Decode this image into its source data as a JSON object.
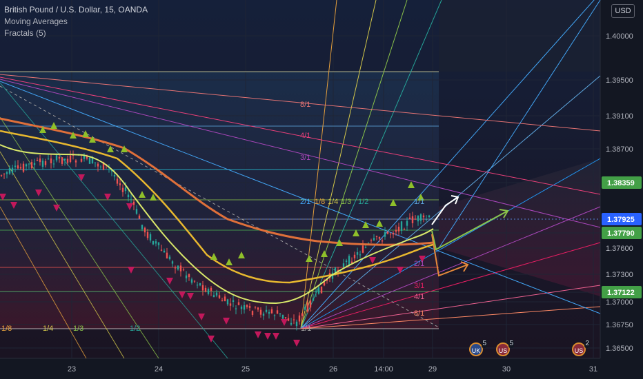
{
  "legend": {
    "title": "British Pound / U.S. Dollar, 15, OANDA",
    "ind1": "Moving Averages",
    "ind2": "Fractals (5)"
  },
  "currency_button": "USD",
  "colors": {
    "background": "#131722",
    "ma_slow": "#e0703a",
    "ma_mid": "#e8b82f",
    "ma_fast": "#d9e86a",
    "bull_candle": "#26a69a",
    "bear_candle": "#ef5350",
    "fractal_up": "#8fbf2a",
    "fractal_down": "#c2185b",
    "price_badge_green": "#43a047",
    "price_badge_blue": "#2962ff"
  },
  "price_axis": {
    "ticks": [
      "1.40000",
      "1.39500",
      "1.39100",
      "1.38700",
      "1.38359",
      "1.37925",
      "1.37790",
      "1.37600",
      "1.37300",
      "1.37122",
      "1.37000",
      "1.36750",
      "1.36500"
    ],
    "badges": [
      {
        "label": "1.38359",
        "color": "#43a047"
      },
      {
        "label": "1.37925",
        "color": "#2962ff"
      },
      {
        "label": "1.37790",
        "color": "#43a047"
      },
      {
        "label": "1.37122",
        "color": "#43a047"
      }
    ]
  },
  "time_axis": [
    "23",
    "24",
    "25",
    "26",
    "14:00",
    "29",
    "30",
    "31"
  ],
  "gann_fan_labels_bottom": [
    "1/8",
    "1/4",
    "1/3",
    "1/2"
  ],
  "gann_fan_labels_upper": [
    "8/1",
    "4/1",
    "3/1",
    "2/1",
    "1/8",
    "1/4",
    "1/3",
    "1/2",
    "1/1"
  ],
  "gann_fan_labels_lower": [
    "2/1",
    "3/1",
    "4/1",
    "8/1",
    "1/1"
  ],
  "events": [
    {
      "name": "uk-event",
      "count": "5",
      "flag": "UK"
    },
    {
      "name": "us-event",
      "count": "5",
      "flag": "US"
    },
    {
      "name": "multi-event",
      "count": "2",
      "flag": "US"
    }
  ]
}
